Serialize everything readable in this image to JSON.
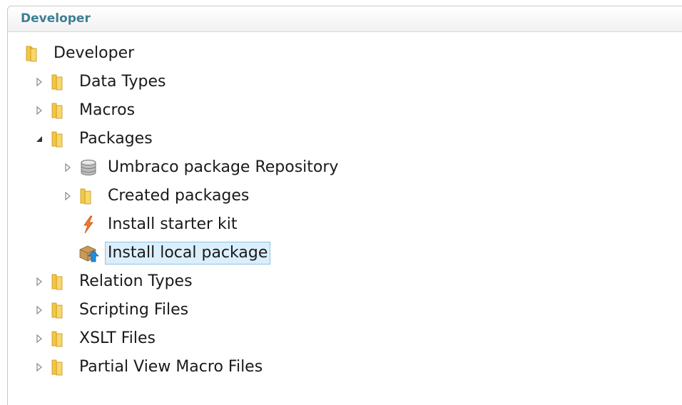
{
  "panel": {
    "title": "Developer"
  },
  "tree": {
    "root": {
      "label": "Developer",
      "icon": "folder-icon"
    },
    "items": [
      {
        "label": "Data Types",
        "icon": "folder-icon",
        "expander": "collapsed"
      },
      {
        "label": "Macros",
        "icon": "folder-icon",
        "expander": "collapsed"
      },
      {
        "label": "Packages",
        "icon": "folder-icon",
        "expander": "expanded"
      },
      {
        "label": "Umbraco package Repository",
        "icon": "database-icon",
        "expander": "collapsed"
      },
      {
        "label": "Created packages",
        "icon": "folder-icon",
        "expander": "collapsed"
      },
      {
        "label": "Install starter kit",
        "icon": "lightning-icon",
        "expander": "none"
      },
      {
        "label": "Install local package",
        "icon": "package-install-icon",
        "expander": "none",
        "selected": true
      },
      {
        "label": "Relation Types",
        "icon": "folder-icon",
        "expander": "collapsed"
      },
      {
        "label": "Scripting Files",
        "icon": "folder-icon",
        "expander": "collapsed"
      },
      {
        "label": "XSLT Files",
        "icon": "folder-icon",
        "expander": "collapsed"
      },
      {
        "label": "Partial View Macro Files",
        "icon": "folder-icon",
        "expander": "collapsed"
      }
    ]
  },
  "colors": {
    "header_text": "#3d7f93",
    "selection_bg": "#dbeefb",
    "selection_border": "#8cc4e8",
    "folder": "#f2c744"
  }
}
